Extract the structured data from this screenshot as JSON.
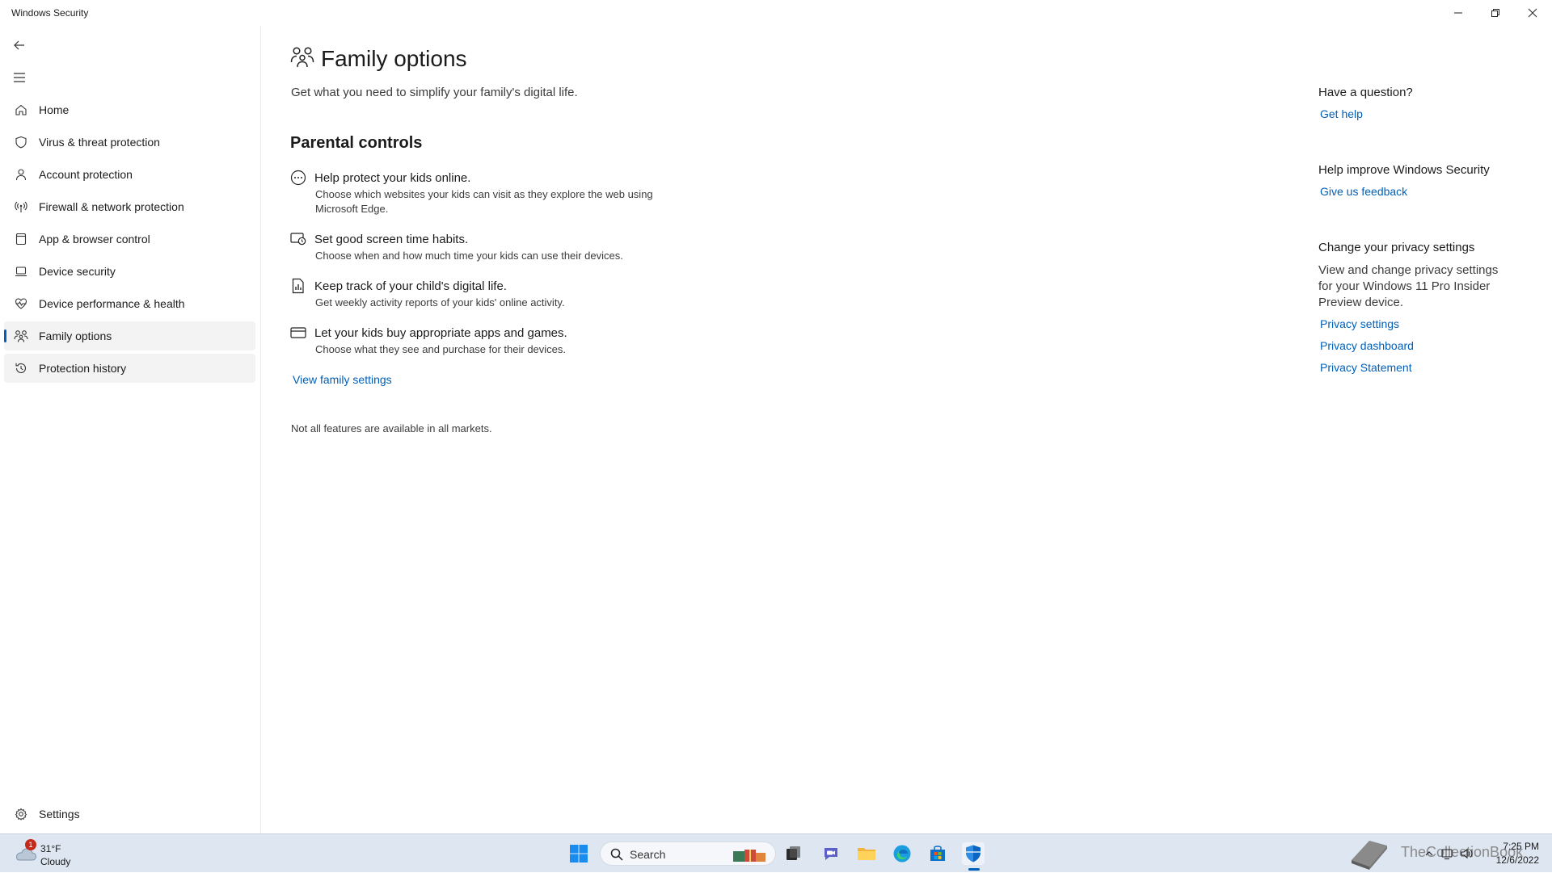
{
  "window": {
    "title": "Windows Security"
  },
  "sidebar": {
    "items": [
      {
        "label": "Home",
        "icon": "home-icon"
      },
      {
        "label": "Virus & threat protection",
        "icon": "shield-icon"
      },
      {
        "label": "Account protection",
        "icon": "person-icon"
      },
      {
        "label": "Firewall & network protection",
        "icon": "antenna-icon"
      },
      {
        "label": "App & browser control",
        "icon": "app-window-icon"
      },
      {
        "label": "Device security",
        "icon": "laptop-icon"
      },
      {
        "label": "Device performance & health",
        "icon": "heart-pulse-icon"
      },
      {
        "label": "Family options",
        "icon": "family-icon"
      },
      {
        "label": "Protection history",
        "icon": "history-icon"
      }
    ],
    "selected": "Family options",
    "settings_label": "Settings"
  },
  "main": {
    "title": "Family options",
    "subtitle": "Get what you need to simplify your family's digital life.",
    "section_title": "Parental controls",
    "features": [
      {
        "title": "Help protect your kids online.",
        "desc": "Choose which websites your kids can visit as they explore the web using Microsoft Edge.",
        "icon": "globe-minus-icon"
      },
      {
        "title": "Set good screen time habits.",
        "desc": "Choose when and how much time your kids can use their devices.",
        "icon": "screen-clock-icon"
      },
      {
        "title": "Keep track of your child's digital life.",
        "desc": "Get weekly activity reports of your kids' online activity.",
        "icon": "report-icon"
      },
      {
        "title": "Let your kids buy appropriate apps and games.",
        "desc": "Choose what they see and purchase for their devices.",
        "icon": "card-icon"
      }
    ],
    "view_link": "View family settings",
    "note": "Not all features are available in all markets."
  },
  "right": {
    "question": {
      "heading": "Have a question?",
      "link": "Get help"
    },
    "improve": {
      "heading": "Help improve Windows Security",
      "link": "Give us feedback"
    },
    "privacy": {
      "heading": "Change your privacy settings",
      "text": "View and change privacy settings for your Windows 11 Pro Insider Preview device.",
      "links": [
        "Privacy settings",
        "Privacy dashboard",
        "Privacy Statement"
      ]
    }
  },
  "taskbar": {
    "weather": {
      "temp": "31°F",
      "condition": "Cloudy",
      "badge": "1"
    },
    "search_placeholder": "Search",
    "watermark": "TheCollectionBook",
    "clock": {
      "time": "7:25 PM",
      "date": "12/6/2022"
    }
  },
  "colors": {
    "accent": "#005fb8",
    "taskbar": "#dde6f1",
    "selected_bg": "#f3f3f3"
  }
}
